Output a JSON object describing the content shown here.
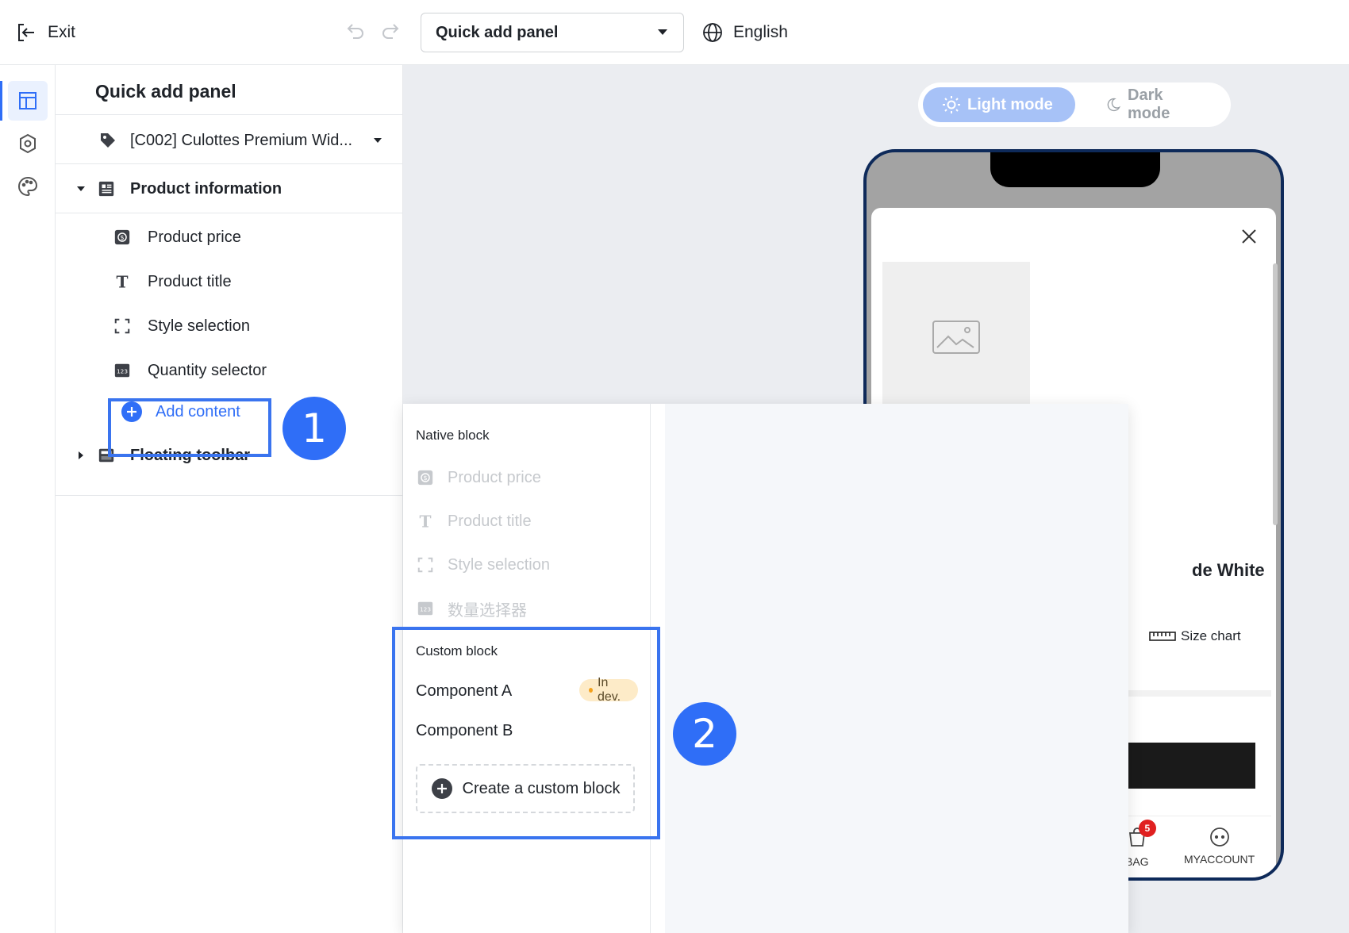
{
  "topbar": {
    "exit_label": "Exit",
    "page_select_value": "Quick add panel",
    "language_label": "English"
  },
  "rail": {
    "items": [
      "layout-icon",
      "settings-icon",
      "palette-icon"
    ],
    "accent": "#2f6ef7"
  },
  "sidebar": {
    "title": "Quick add panel",
    "product_selector": "[C002] Culottes Premium Wid...",
    "sections": [
      {
        "label": "Product information",
        "expanded": true,
        "items": [
          "Product price",
          "Product title",
          "Style selection",
          "Quantity selector"
        ],
        "add_label": "Add content"
      },
      {
        "label": "Floating toolbar",
        "expanded": false
      }
    ]
  },
  "annotations": {
    "step1": "1",
    "step2": "2",
    "color": "#3a74ef"
  },
  "preview": {
    "light_mode": "Light mode",
    "dark_mode": "Dark mode",
    "product_name_fragment": "de White",
    "size_chart": "Size chart",
    "tabs": {
      "bag": "BAG",
      "bag_count": "5",
      "account": "MYACCOUNT"
    }
  },
  "popover": {
    "native_group": "Native block",
    "native_items": [
      "Product price",
      "Product title",
      "Style selection",
      "数量选择器"
    ],
    "custom_group": "Custom block",
    "custom_items": [
      {
        "label": "Component A",
        "status": "In dev."
      },
      {
        "label": "Component B"
      }
    ],
    "create_label": "Create a custom block"
  }
}
